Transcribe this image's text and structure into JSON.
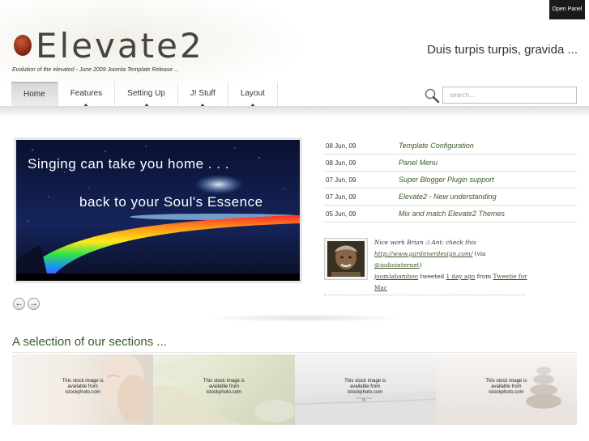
{
  "header": {
    "open_panel": "Open Panel",
    "logo": "Elevate2",
    "tagline": "Evolution of the elevated - June 2009 Joomla Template Release ...",
    "headline": "Duis turpis turpis, gravida ..."
  },
  "nav": {
    "items": [
      {
        "label": "Home"
      },
      {
        "label": "Features"
      },
      {
        "label": "Setting Up"
      },
      {
        "label": "J! Stuff"
      },
      {
        "label": "Layout"
      }
    ]
  },
  "search": {
    "placeholder": "search..."
  },
  "slideshow": {
    "caption1": "Singing can take you home . . .",
    "caption2": "back to your Soul's Essence",
    "prev": "←",
    "next": "→"
  },
  "articles": [
    {
      "date": "08 Jun, 09",
      "title": "Template Configuration"
    },
    {
      "date": "08 Jun, 09",
      "title": "Panel Menu"
    },
    {
      "date": "07 Jun, 09",
      "title": "Super Blogger Plugin support"
    },
    {
      "date": "07 Jun, 09",
      "title": "Elevate2 - New understanding"
    },
    {
      "date": "05 Jun, 09",
      "title": "Mix and match Elevate2 Themes"
    }
  ],
  "tweet": {
    "text": "Nice work Brian :) Ant: check this",
    "link": "http://www.gardenerdesign.com/",
    "via_pre": "(via ",
    "via": "@indiointernet",
    "via_post": ")",
    "user": "joomlabamboo",
    "tweeted": "tweeted",
    "time": "1 day ago",
    "from": "from",
    "source_1": "Tweetie for",
    "source_2": "Mac"
  },
  "sections": {
    "heading": "A selection of our sections ...",
    "items": [
      {
        "text": "This stock image is available from istockphoto.com"
      },
      {
        "text": "This stock image is available from istockphoto.com"
      },
      {
        "text": "This stock image is available from istockphoto.com"
      },
      {
        "text": "This stock image is available from istockphoto.com"
      }
    ]
  },
  "colors": {
    "accent_green": "#3a5a2a",
    "logo_red": "#8e2d17",
    "panel_black": "#1a1a1a"
  }
}
